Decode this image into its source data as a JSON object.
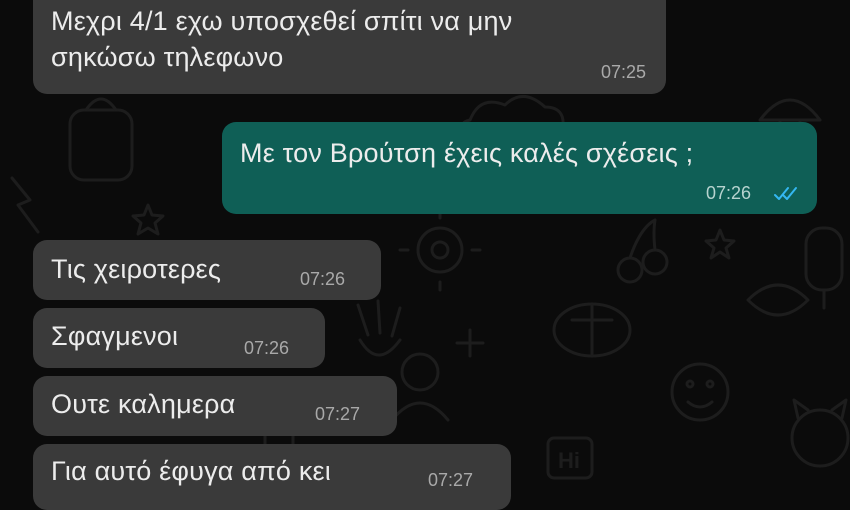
{
  "messages": [
    {
      "direction": "incoming",
      "lines": [
        "Μεχρι 4/1 εχω υποσχεθεί σπίτι να μην",
        "σηκώσω τηλεφωνο"
      ],
      "time": "07:25"
    },
    {
      "direction": "outgoing",
      "lines": [
        "Με τον Βρούτση έχεις καλές σχέσεις ;"
      ],
      "time": "07:26",
      "status": "read",
      "status_icon": "double-check-icon",
      "status_color": "#34b7f1"
    },
    {
      "direction": "incoming",
      "lines": [
        "Τις χειροτερες"
      ],
      "time": "07:26"
    },
    {
      "direction": "incoming",
      "lines": [
        "Σφαγμενοι"
      ],
      "time": "07:26"
    },
    {
      "direction": "incoming",
      "lines": [
        "Ουτε καλημερα"
      ],
      "time": "07:27"
    },
    {
      "direction": "incoming",
      "lines": [
        "Για αυτό έφυγα από κει"
      ],
      "time": "07:27"
    }
  ],
  "wallpaper": {
    "doodle_sticker_text": "Hi"
  },
  "colors": {
    "background": "#0b0b0b",
    "incoming_bubble": "#3a3a3a",
    "outgoing_bubble": "#0f5f56",
    "doodle": "#1c1c1c"
  }
}
